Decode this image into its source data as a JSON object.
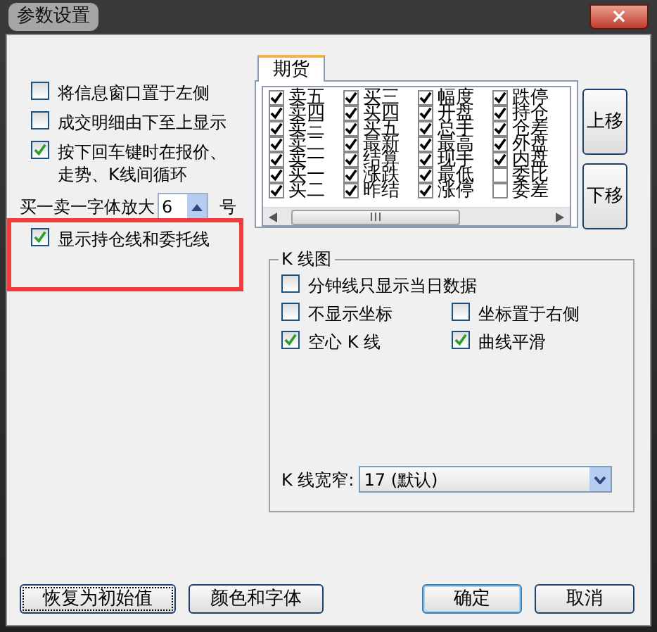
{
  "window": {
    "title": "参数设置",
    "close": "×"
  },
  "options": [
    {
      "kind": "checkbox",
      "label": "将信息窗口置于左侧",
      "checked": false
    },
    {
      "kind": "checkbox",
      "label": "成交明细由下至上显示",
      "checked": false
    },
    {
      "kind": "checkbox",
      "label": "按下回车键时在报价、走势、K线间循环",
      "checked": true
    },
    {
      "kind": "spin",
      "label": "买一卖一字体放大",
      "value": "6",
      "unit": "号"
    },
    {
      "kind": "checkbox",
      "label": "显示持仓线和委托线",
      "checked": true
    }
  ],
  "highlight": true,
  "tabs": [
    {
      "label": "期货",
      "selected": true
    }
  ],
  "fields": [
    [
      {
        "label": "卖五",
        "checked": true
      },
      {
        "label": "卖四",
        "checked": true
      },
      {
        "label": "卖三",
        "checked": true
      },
      {
        "label": "卖二",
        "checked": true
      },
      {
        "label": "卖一",
        "checked": true
      },
      {
        "label": "买一",
        "checked": true
      },
      {
        "label": "买二",
        "checked": true
      }
    ],
    [
      {
        "label": "买三",
        "checked": true
      },
      {
        "label": "买四",
        "checked": true
      },
      {
        "label": "买五",
        "checked": true
      },
      {
        "label": "最新",
        "checked": true
      },
      {
        "label": "结算",
        "checked": true
      },
      {
        "label": "涨跌",
        "checked": true
      },
      {
        "label": "昨结",
        "checked": true
      }
    ],
    [
      {
        "label": "幅度",
        "checked": true
      },
      {
        "label": "开盘",
        "checked": true
      },
      {
        "label": "总手",
        "checked": true
      },
      {
        "label": "最高",
        "checked": true
      },
      {
        "label": "现手",
        "checked": true
      },
      {
        "label": "最低",
        "checked": true
      },
      {
        "label": "涨停",
        "checked": true
      }
    ],
    [
      {
        "label": "跌停",
        "checked": true
      },
      {
        "label": "持仓",
        "checked": true
      },
      {
        "label": "仓差",
        "checked": true
      },
      {
        "label": "外盘",
        "checked": true
      },
      {
        "label": "内盘",
        "checked": true
      },
      {
        "label": "委比",
        "checked": false
      },
      {
        "label": "委差",
        "checked": false
      }
    ]
  ],
  "move_buttons": [
    "上移",
    "下移"
  ],
  "kline": {
    "title": "K 线图",
    "options": [
      [
        {
          "label": "分钟线只显示当日数据",
          "checked": false
        }
      ],
      [
        {
          "label": "不显示坐标",
          "checked": false
        },
        {
          "label": "坐标置于右侧",
          "checked": false
        }
      ],
      [
        {
          "label": "空心 K 线",
          "checked": true
        },
        {
          "label": "曲线平滑",
          "checked": true
        }
      ]
    ],
    "width_label": "K 线宽窄:",
    "width_value": "17 (默认)"
  },
  "buttons": [
    {
      "label": "恢复为初始值",
      "focused": true
    },
    {
      "label": "颜色和字体",
      "focused": false
    },
    {
      "label": "确定",
      "focused": false,
      "default": true
    },
    {
      "label": "取消",
      "focused": false
    }
  ]
}
